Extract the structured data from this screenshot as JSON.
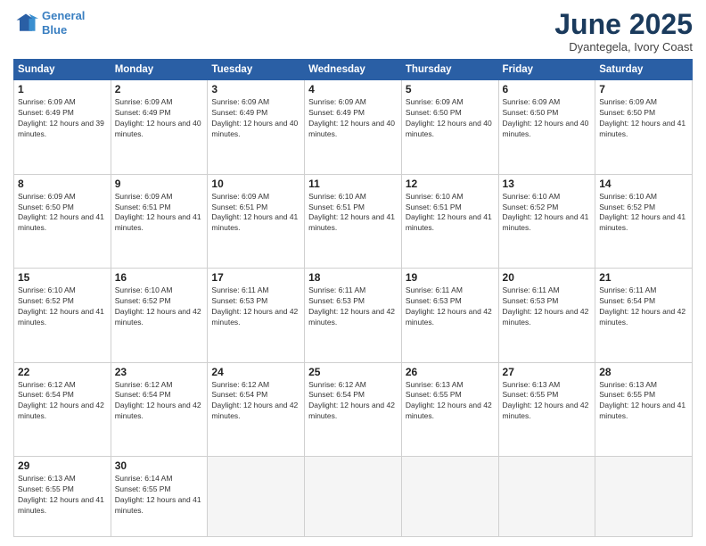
{
  "header": {
    "logo_line1": "General",
    "logo_line2": "Blue",
    "month_title": "June 2025",
    "location": "Dyantegela, Ivory Coast"
  },
  "weekdays": [
    "Sunday",
    "Monday",
    "Tuesday",
    "Wednesday",
    "Thursday",
    "Friday",
    "Saturday"
  ],
  "weeks": [
    [
      {
        "day": "1",
        "sunrise": "6:09 AM",
        "sunset": "6:49 PM",
        "daylight": "12 hours and 39 minutes."
      },
      {
        "day": "2",
        "sunrise": "6:09 AM",
        "sunset": "6:49 PM",
        "daylight": "12 hours and 40 minutes."
      },
      {
        "day": "3",
        "sunrise": "6:09 AM",
        "sunset": "6:49 PM",
        "daylight": "12 hours and 40 minutes."
      },
      {
        "day": "4",
        "sunrise": "6:09 AM",
        "sunset": "6:49 PM",
        "daylight": "12 hours and 40 minutes."
      },
      {
        "day": "5",
        "sunrise": "6:09 AM",
        "sunset": "6:50 PM",
        "daylight": "12 hours and 40 minutes."
      },
      {
        "day": "6",
        "sunrise": "6:09 AM",
        "sunset": "6:50 PM",
        "daylight": "12 hours and 40 minutes."
      },
      {
        "day": "7",
        "sunrise": "6:09 AM",
        "sunset": "6:50 PM",
        "daylight": "12 hours and 41 minutes."
      }
    ],
    [
      {
        "day": "8",
        "sunrise": "6:09 AM",
        "sunset": "6:50 PM",
        "daylight": "12 hours and 41 minutes."
      },
      {
        "day": "9",
        "sunrise": "6:09 AM",
        "sunset": "6:51 PM",
        "daylight": "12 hours and 41 minutes."
      },
      {
        "day": "10",
        "sunrise": "6:09 AM",
        "sunset": "6:51 PM",
        "daylight": "12 hours and 41 minutes."
      },
      {
        "day": "11",
        "sunrise": "6:10 AM",
        "sunset": "6:51 PM",
        "daylight": "12 hours and 41 minutes."
      },
      {
        "day": "12",
        "sunrise": "6:10 AM",
        "sunset": "6:51 PM",
        "daylight": "12 hours and 41 minutes."
      },
      {
        "day": "13",
        "sunrise": "6:10 AM",
        "sunset": "6:52 PM",
        "daylight": "12 hours and 41 minutes."
      },
      {
        "day": "14",
        "sunrise": "6:10 AM",
        "sunset": "6:52 PM",
        "daylight": "12 hours and 41 minutes."
      }
    ],
    [
      {
        "day": "15",
        "sunrise": "6:10 AM",
        "sunset": "6:52 PM",
        "daylight": "12 hours and 41 minutes."
      },
      {
        "day": "16",
        "sunrise": "6:10 AM",
        "sunset": "6:52 PM",
        "daylight": "12 hours and 42 minutes."
      },
      {
        "day": "17",
        "sunrise": "6:11 AM",
        "sunset": "6:53 PM",
        "daylight": "12 hours and 42 minutes."
      },
      {
        "day": "18",
        "sunrise": "6:11 AM",
        "sunset": "6:53 PM",
        "daylight": "12 hours and 42 minutes."
      },
      {
        "day": "19",
        "sunrise": "6:11 AM",
        "sunset": "6:53 PM",
        "daylight": "12 hours and 42 minutes."
      },
      {
        "day": "20",
        "sunrise": "6:11 AM",
        "sunset": "6:53 PM",
        "daylight": "12 hours and 42 minutes."
      },
      {
        "day": "21",
        "sunrise": "6:11 AM",
        "sunset": "6:54 PM",
        "daylight": "12 hours and 42 minutes."
      }
    ],
    [
      {
        "day": "22",
        "sunrise": "6:12 AM",
        "sunset": "6:54 PM",
        "daylight": "12 hours and 42 minutes."
      },
      {
        "day": "23",
        "sunrise": "6:12 AM",
        "sunset": "6:54 PM",
        "daylight": "12 hours and 42 minutes."
      },
      {
        "day": "24",
        "sunrise": "6:12 AM",
        "sunset": "6:54 PM",
        "daylight": "12 hours and 42 minutes."
      },
      {
        "day": "25",
        "sunrise": "6:12 AM",
        "sunset": "6:54 PM",
        "daylight": "12 hours and 42 minutes."
      },
      {
        "day": "26",
        "sunrise": "6:13 AM",
        "sunset": "6:55 PM",
        "daylight": "12 hours and 42 minutes."
      },
      {
        "day": "27",
        "sunrise": "6:13 AM",
        "sunset": "6:55 PM",
        "daylight": "12 hours and 42 minutes."
      },
      {
        "day": "28",
        "sunrise": "6:13 AM",
        "sunset": "6:55 PM",
        "daylight": "12 hours and 41 minutes."
      }
    ],
    [
      {
        "day": "29",
        "sunrise": "6:13 AM",
        "sunset": "6:55 PM",
        "daylight": "12 hours and 41 minutes."
      },
      {
        "day": "30",
        "sunrise": "6:14 AM",
        "sunset": "6:55 PM",
        "daylight": "12 hours and 41 minutes."
      },
      null,
      null,
      null,
      null,
      null
    ]
  ]
}
